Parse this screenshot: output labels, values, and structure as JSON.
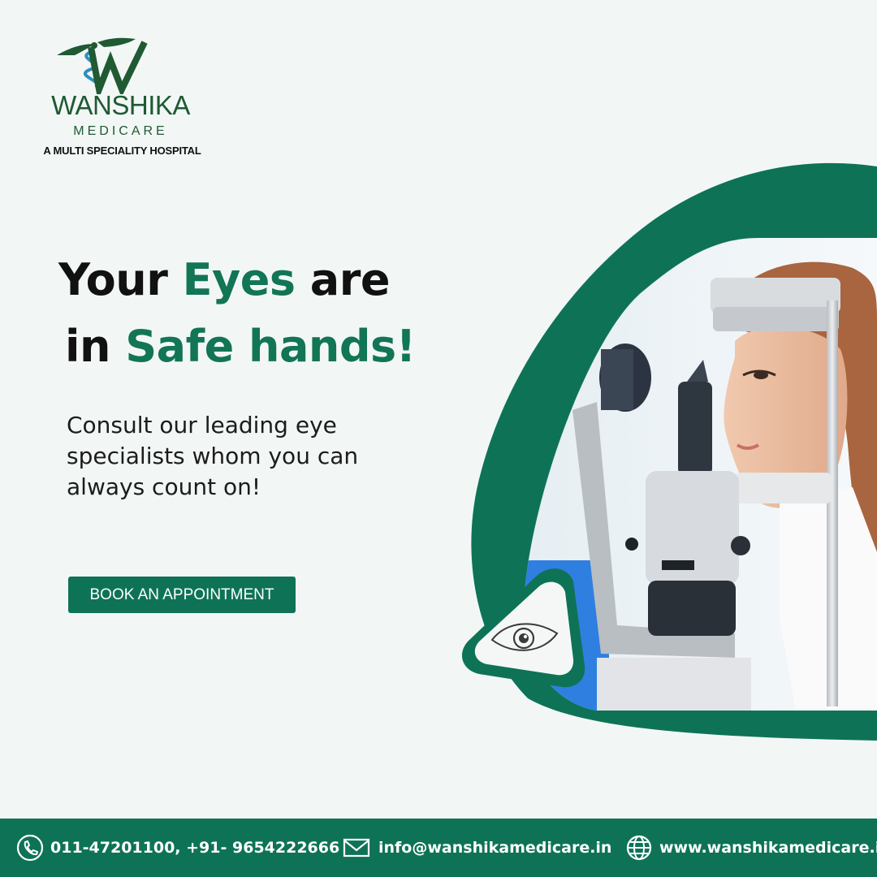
{
  "brand": {
    "name": "WANSHIKA",
    "subname": "MEDICARE",
    "tagline": "A MULTI SPECIALITY HOSPITAL"
  },
  "headline": {
    "line1_a": "Your ",
    "line1_accent": "Eyes",
    "line1_b": " are",
    "line2_a": "in ",
    "line2_accent": "Safe hands!"
  },
  "description": "Consult our leading eye specialists whom you can always count on!",
  "cta": {
    "label": "BOOK AN APPOINTMENT"
  },
  "footer": {
    "phone": "011-47201100, +91- 9654222666",
    "email": "info@wanshikamedicare.in",
    "website": "www.wanshikamedicare.in"
  },
  "icons": {
    "phone": "phone-icon",
    "email": "envelope-icon",
    "website": "globe-icon",
    "eye": "eye-icon",
    "logo": "caduceus-logo-icon"
  },
  "colors": {
    "brand_green": "#0e7356",
    "logo_green": "#1f5a33",
    "background": "#f2f7f6",
    "text_dark": "#111111"
  }
}
